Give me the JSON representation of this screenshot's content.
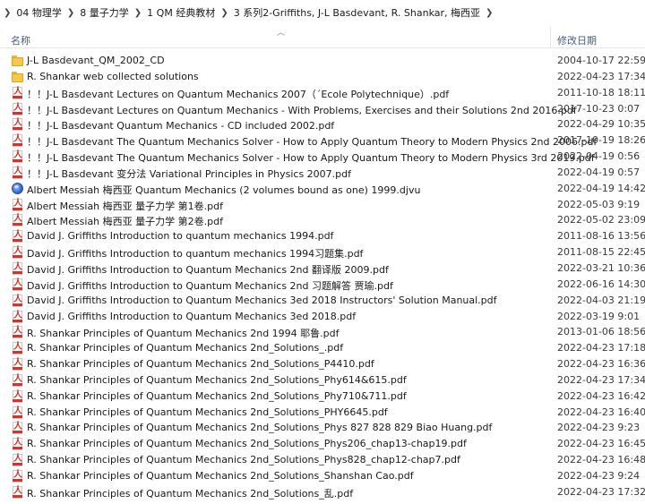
{
  "breadcrumb": [
    "04 物理学",
    "8 量子力学",
    "1 QM  经典教材",
    "3 系列2-Griffiths, J-L Basdevant, R. Shankar, 梅西亚"
  ],
  "columns": {
    "name": "名称",
    "modified": "修改日期"
  },
  "files": [
    {
      "icon": "folder-icon",
      "name": "J-L Basdevant_QM_2002_CD",
      "date": "2004-10-17 22:59"
    },
    {
      "icon": "folder-icon",
      "name": "R. Shankar   web collected solutions",
      "date": "2022-04-23 17:34"
    },
    {
      "icon": "pdf-icon",
      "name": "！！J-L Basdevant   Lectures on Quantum Mechanics   2007（´Ecole Polytechnique）.pdf",
      "date": "2011-10-18 18:11"
    },
    {
      "icon": "pdf-icon",
      "name": "！！J-L Basdevant   Lectures on Quantum Mechanics - With Problems, Exercises and their Solutions  2nd 2016.pdf",
      "date": "2017-10-23 0:07"
    },
    {
      "icon": "pdf-icon",
      "name": "！！J-L Basdevant   Quantum Mechanics - CD included  2002.pdf",
      "date": "2022-04-29 10:35"
    },
    {
      "icon": "pdf-icon",
      "name": "！！J-L Basdevant   The Quantum Mechanics Solver - How to Apply Quantum Theory to Modern Physics  2nd 2006.pdf",
      "date": "2017-10-19 18:26"
    },
    {
      "icon": "pdf-icon",
      "name": "！！J-L Basdevant   The Quantum Mechanics Solver - How to Apply Quantum Theory to Modern Physics  3rd 2019.pdf",
      "date": "2022-04-19 0:56"
    },
    {
      "icon": "pdf-icon",
      "name": "！！J-L Basdevant   变分法 Variational Principles in Physics  2007.pdf",
      "date": "2022-04-19 0:57"
    },
    {
      "icon": "djvu-icon",
      "name": "Albert Messiah 梅西亚   Quantum Mechanics (2 volumes bound as one)  1999.djvu",
      "date": "2022-04-19 14:42"
    },
    {
      "icon": "pdf-icon",
      "name": "Albert Messiah 梅西亚   量子力学 第1卷.pdf",
      "date": "2022-05-03 9:19"
    },
    {
      "icon": "pdf-icon",
      "name": "Albert Messiah 梅西亚   量子力学 第2卷.pdf",
      "date": "2022-05-02 23:09"
    },
    {
      "icon": "pdf-icon",
      "name": "David J. Griffiths   Introduction to quantum mechanics   1994.pdf",
      "date": "2011-08-16 13:56"
    },
    {
      "icon": "pdf-icon",
      "name": "David J. Griffiths   Introduction to quantum mechanics   1994习题集.pdf",
      "date": "2011-08-15 22:45"
    },
    {
      "icon": "pdf-icon",
      "name": "David J. Griffiths   Introduction to Quantum Mechanics  2nd 翻译版 2009.pdf",
      "date": "2022-03-21 10:36"
    },
    {
      "icon": "pdf-icon",
      "name": "David J. Griffiths   Introduction to Quantum Mechanics  2nd 习题解答 贾瑜.pdf",
      "date": "2022-06-16 14:30"
    },
    {
      "icon": "pdf-icon",
      "name": "David J. Griffiths   Introduction to Quantum Mechanics  3ed 2018 Instructors' Solution Manual.pdf",
      "date": "2022-04-03 21:19"
    },
    {
      "icon": "pdf-icon",
      "name": "David J. Griffiths   Introduction to Quantum Mechanics  3ed 2018.pdf",
      "date": "2022-03-19 9:01"
    },
    {
      "icon": "pdf-icon",
      "name": "R. Shankar   Principles of Quantum Mechanics  2nd 1994 耶鲁.pdf",
      "date": "2013-01-06 18:56"
    },
    {
      "icon": "pdf-icon",
      "name": "R. Shankar   Principles of Quantum Mechanics  2nd_Solutions_.pdf",
      "date": "2022-04-23 17:18"
    },
    {
      "icon": "pdf-icon",
      "name": "R. Shankar   Principles of Quantum Mechanics  2nd_Solutions_P4410.pdf",
      "date": "2022-04-23 16:36"
    },
    {
      "icon": "pdf-icon",
      "name": "R. Shankar   Principles of Quantum Mechanics  2nd_Solutions_Phy614&615.pdf",
      "date": "2022-04-23 17:34"
    },
    {
      "icon": "pdf-icon",
      "name": "R. Shankar   Principles of Quantum Mechanics  2nd_Solutions_Phy710&711.pdf",
      "date": "2022-04-23 16:42"
    },
    {
      "icon": "pdf-icon",
      "name": "R. Shankar   Principles of Quantum Mechanics  2nd_Solutions_PHY6645.pdf",
      "date": "2022-04-23 16:40"
    },
    {
      "icon": "pdf-icon",
      "name": "R. Shankar   Principles of Quantum Mechanics  2nd_Solutions_Phys 827 828 829 Biao Huang.pdf",
      "date": "2022-04-23 9:23"
    },
    {
      "icon": "pdf-icon",
      "name": "R. Shankar   Principles of Quantum Mechanics  2nd_Solutions_Phys206_chap13-chap19.pdf",
      "date": "2022-04-23 16:45"
    },
    {
      "icon": "pdf-icon",
      "name": "R. Shankar   Principles of Quantum Mechanics  2nd_Solutions_Phys828_chap12-chap7.pdf",
      "date": "2022-04-23 16:48"
    },
    {
      "icon": "pdf-icon",
      "name": "R. Shankar   Principles of Quantum Mechanics  2nd_Solutions_Shanshan Cao.pdf",
      "date": "2022-04-23 9:24"
    },
    {
      "icon": "pdf-icon",
      "name": "R. Shankar   Principles of Quantum Mechanics  2nd_Solutions_乱.pdf",
      "date": "2022-04-23 17:32"
    }
  ]
}
